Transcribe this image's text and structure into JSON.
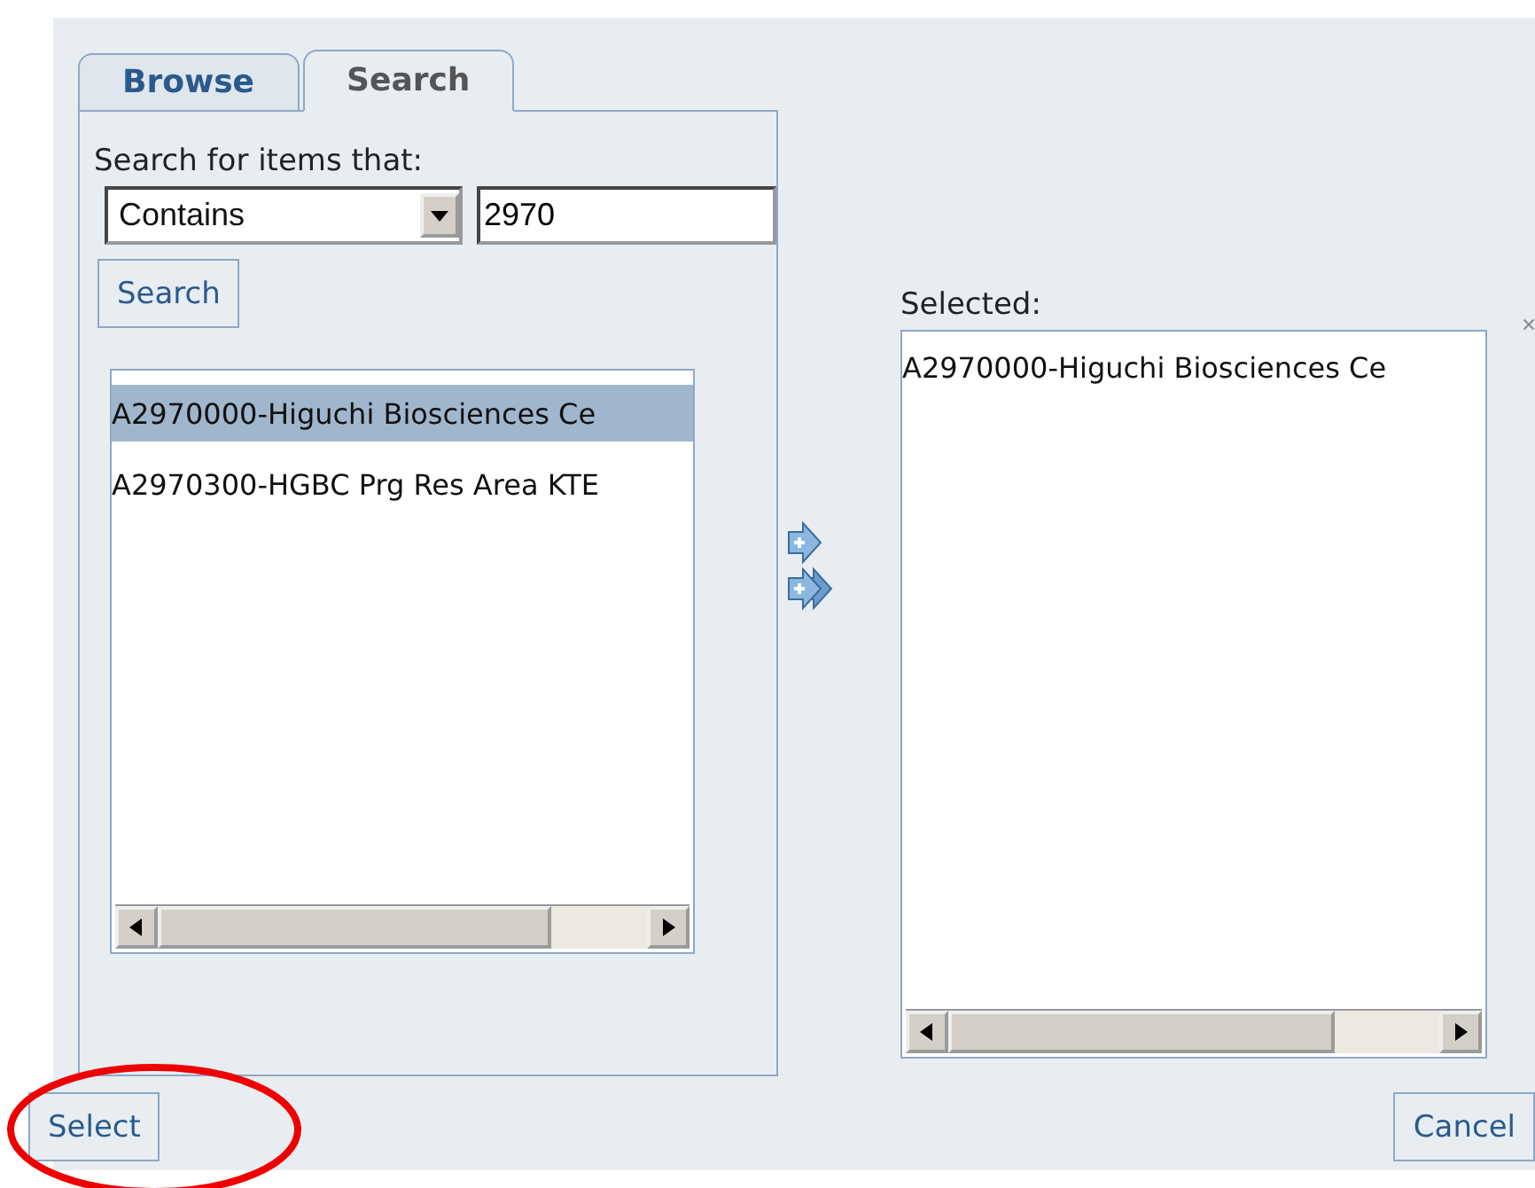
{
  "tabs": [
    {
      "label": "Browse",
      "selected": false
    },
    {
      "label": "Search",
      "selected": true
    }
  ],
  "search": {
    "prompt": "Search for items that:",
    "match_mode": "Contains",
    "query": "2970",
    "button": "Search"
  },
  "results": [
    {
      "label": "A2970000-Higuchi Biosciences Ce",
      "selected": true
    },
    {
      "label": "A2970300-HGBC Prg Res Area KTE",
      "selected": false
    }
  ],
  "selected_panel": {
    "label": "Selected:",
    "items": [
      {
        "label": "A2970000-Higuchi Biosciences Ce"
      }
    ]
  },
  "footer": {
    "select_button": {
      "label": "Select",
      "circled": true
    },
    "cancel_button": {
      "label": "Cancel"
    }
  }
}
